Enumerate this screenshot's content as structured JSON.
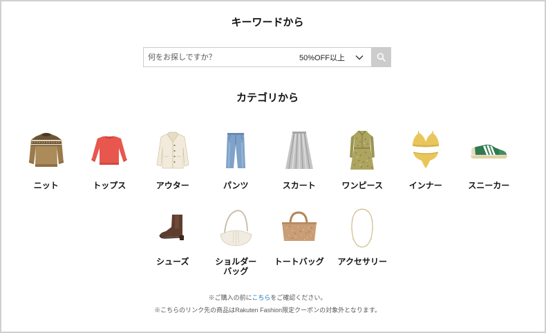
{
  "keyword_section": {
    "title": "キーワードから"
  },
  "search": {
    "placeholder": "何をお探しですか？",
    "discount_filter": {
      "selected": "50%OFF以上"
    },
    "chevron_icon": "chevron-down-icon",
    "button_icon": "search-icon"
  },
  "category_section": {
    "title": "カテゴリから",
    "items": [
      {
        "label": "ニット",
        "icon": "knit-sweater-icon"
      },
      {
        "label": "トップス",
        "icon": "sweatshirt-top-icon"
      },
      {
        "label": "アウター",
        "icon": "jacket-icon"
      },
      {
        "label": "パンツ",
        "icon": "jeans-icon"
      },
      {
        "label": "スカート",
        "icon": "pleated-skirt-icon"
      },
      {
        "label": "ワンピース",
        "icon": "dress-icon"
      },
      {
        "label": "インナー",
        "icon": "lingerie-icon"
      },
      {
        "label": "スニーカー",
        "icon": "sneaker-icon"
      },
      {
        "label": "シューズ",
        "icon": "ankle-boot-icon"
      },
      {
        "label": "ショルダー\nバッグ",
        "icon": "shoulder-bag-icon"
      },
      {
        "label": "トートバッグ",
        "icon": "tote-bag-icon"
      },
      {
        "label": "アクセサリー",
        "icon": "necklace-icon"
      }
    ]
  },
  "notes": {
    "note1": {
      "prefix": "※ご購入の前に",
      "link": "こちら",
      "suffix": "をご確認ください。"
    },
    "note2": "※こちらのリンク先の商品はRakuten Fashion限定クーポンの対象外となります。"
  },
  "colors": {
    "text": "#111111",
    "border": "#cfcfcf",
    "search_button": "#cccccc",
    "link": "#1f78c1",
    "note": "#555555"
  }
}
